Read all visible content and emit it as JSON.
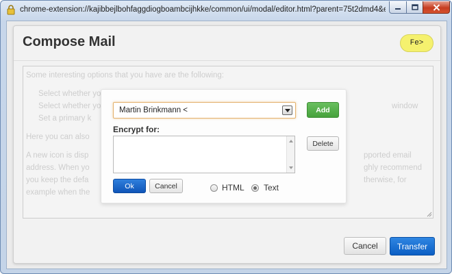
{
  "window": {
    "title": "chrome-extension://kajibbejlbohfaggdiogboambcijhkke/common/ui/modal/editor.html?parent=75t2dmd4&ed..."
  },
  "compose": {
    "title": "Compose Mail",
    "key_badge": "Fe>"
  },
  "editor": {
    "paragraphs": {
      "p1": "Some interesting options that you have are the following:",
      "l1": "Select whether yo",
      "l1b": "window",
      "l2": "Select whether yo",
      "l3": "Set a primary k",
      "p2": "Here you can also",
      "p3a": "A new icon is disp",
      "p3a_tail": "pported email",
      "p3b": "address. When yo",
      "p3b_tail": "ghly recommend",
      "p3c": "you keep the defa",
      "p3c_tail": "therwise, for",
      "p3d": "example when the"
    }
  },
  "popup": {
    "recipient_value": "Martin Brinkmann <",
    "add_label": "Add",
    "encrypt_label": "Encrypt for:",
    "delete_label": "Delete",
    "ok_label": "Ok",
    "cancel_label": "Cancel",
    "format_html_label": "HTML",
    "format_text_label": "Text",
    "selected_format": "Text"
  },
  "footer": {
    "cancel_label": "Cancel",
    "transfer_label": "Transfer"
  },
  "colors": {
    "primary_blue": "#0b5ec4",
    "add_green": "#46a23c",
    "badge_yellow": "#f5f16e"
  }
}
